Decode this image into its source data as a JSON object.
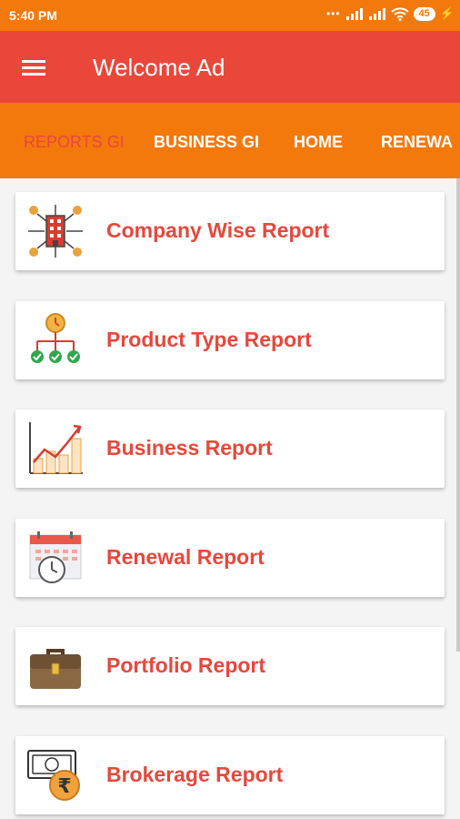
{
  "status_bar": {
    "time": "5:40 PM",
    "battery": "45"
  },
  "app_bar": {
    "title": "Welcome Ad",
    "menu_icon": "hamburger-menu-icon"
  },
  "tabs": [
    {
      "label": "REPORTS GI",
      "active": true
    },
    {
      "label": "BUSINESS GI",
      "active": false
    },
    {
      "label": "HOME",
      "active": false
    },
    {
      "label": "RENEWA",
      "active": false
    }
  ],
  "reports": [
    {
      "label": "Company Wise Report",
      "icon": "company-structure-icon"
    },
    {
      "label": "Product Type Report",
      "icon": "product-hierarchy-icon"
    },
    {
      "label": "Business Report",
      "icon": "growth-chart-icon"
    },
    {
      "label": "Renewal Report",
      "icon": "calendar-clock-icon"
    },
    {
      "label": "Portfolio Report",
      "icon": "briefcase-icon"
    },
    {
      "label": "Brokerage Report",
      "icon": "rupee-note-icon"
    }
  ],
  "colors": {
    "status_bar": "#f4790d",
    "app_bar": "#e8473a",
    "tab_bar": "#f4790d",
    "accent_text": "#e8473a"
  }
}
